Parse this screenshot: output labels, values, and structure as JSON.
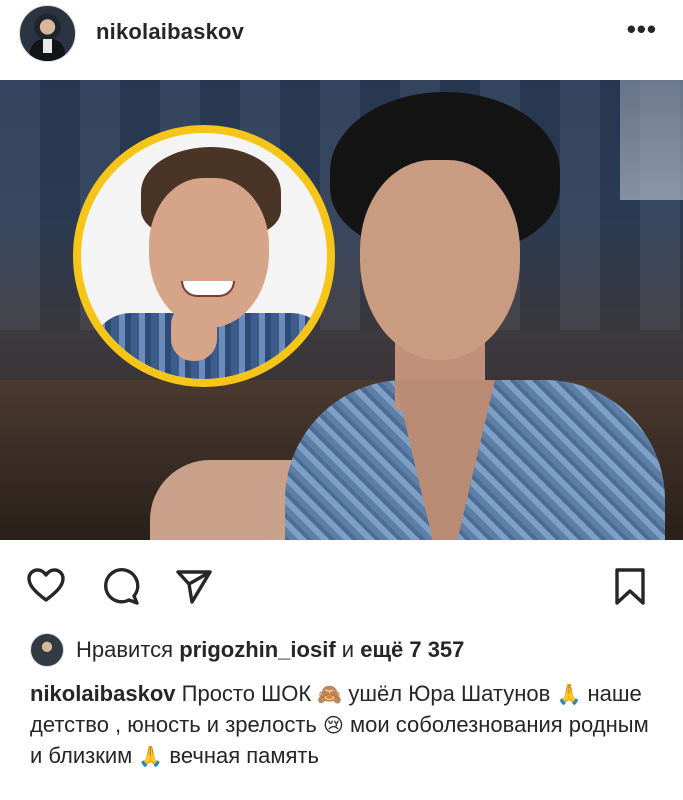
{
  "post": {
    "username": "nikolaibaskov",
    "more_label": "•••"
  },
  "photo": {
    "alt": ""
  },
  "actions": {
    "like_icon": "heart-icon",
    "comment_icon": "comment-icon",
    "share_icon": "send-icon",
    "save_icon": "bookmark-icon"
  },
  "likes": {
    "prefix": "Нравится",
    "user": "prigozhin_iosif",
    "middle": "и",
    "more": "ещё 7 357"
  },
  "caption": {
    "username": "nikolaibaskov",
    "part1": "Просто ШОК",
    "emoji1": "🙈",
    "part2": "ушёл Юра Шатунов",
    "emoji2": "🙏",
    "part3": "наше детство , юность и зрелость",
    "emoji3": "😢",
    "part4": "мои соболезнования родным и близким",
    "emoji4": "🙏",
    "part5": "вечная память"
  },
  "colors": {
    "text": "#262626",
    "frame": "#f5c518"
  }
}
